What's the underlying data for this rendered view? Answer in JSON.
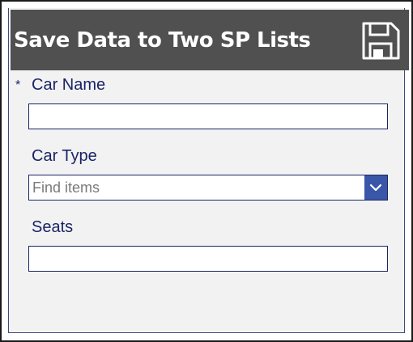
{
  "header": {
    "title": "Save Data to Two SP Lists",
    "save_icon": "save-icon"
  },
  "form": {
    "car_name": {
      "label": "Car Name",
      "required_marker": "*",
      "value": ""
    },
    "car_type": {
      "label": "Car Type",
      "placeholder": "Find items",
      "dropdown_icon": "chevron-down-icon"
    },
    "seats": {
      "label": "Seats",
      "value": ""
    }
  },
  "colors": {
    "header_bg": "#505050",
    "label_color": "#1a2466",
    "dropdown_btn": "#3a56a8",
    "form_bg": "#f2f2f2"
  }
}
